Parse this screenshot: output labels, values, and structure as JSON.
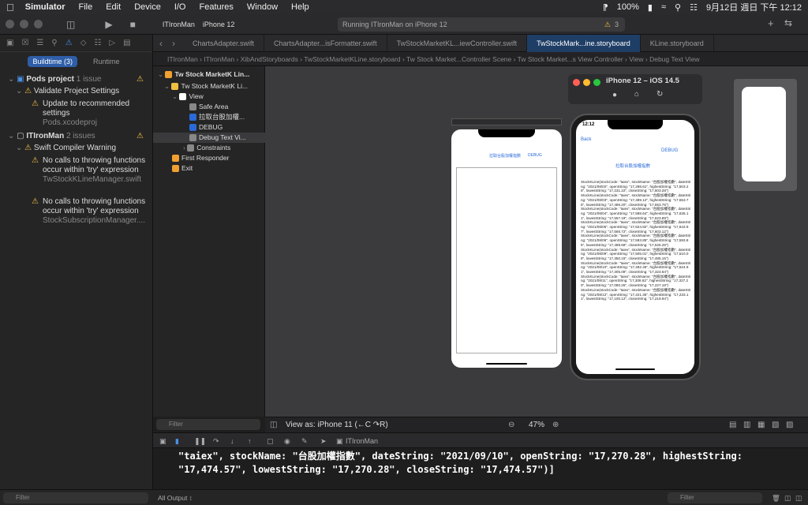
{
  "menubar": {
    "app": "Simulator",
    "items": [
      "File",
      "Edit",
      "Device",
      "I/O",
      "Features",
      "Window",
      "Help"
    ],
    "battery": "100%",
    "datetime": "9月12日 週日 下午 12:12"
  },
  "toolbar": {
    "scheme": "ITIronMan",
    "device": "iPhone 12",
    "status": "Running ITIronMan on iPhone 12",
    "warning_count": "3"
  },
  "nav": {
    "segments": [
      "Buildtime (3)",
      "Runtime"
    ],
    "issues": [
      {
        "title": "Pods project",
        "count": "1 issue"
      },
      {
        "title": "Validate Project Settings"
      },
      {
        "title": "Update to recommended settings",
        "file": "Pods.xcodeproj"
      },
      {
        "title": "ITIronMan",
        "count": "2 issues"
      },
      {
        "title": "Swift Compiler Warning"
      },
      {
        "title": "No calls to throwing functions occur within 'try' expression",
        "file": "TwStockKLineManager.swift"
      },
      {
        "title": "No calls to throwing functions occur within 'try' expression",
        "file": "StockSubscriptionManager...."
      }
    ],
    "filter_placeholder": "Filter"
  },
  "tabs": [
    "ChartsAdapter.swift",
    "ChartsAdapter...isFormatter.swift",
    "TwStockMarketKL...iewController.swift",
    "TwStockMark...ine.storyboard",
    "KLine.storyboard"
  ],
  "breadcrumb": [
    "ITIronMan",
    "ITIronMan",
    "XibAndStoryboards",
    "TwStockMarketKLine.storyboard",
    "Tw Stock Market...Controller Scene",
    "Tw Stock Market...s View Controller",
    "View",
    "Debug Text View"
  ],
  "outline": [
    {
      "label": "Tw Stock MarketK Lin...",
      "color": "#f0a030",
      "indent": 0
    },
    {
      "label": "Tw Stock MarketK Li...",
      "color": "#f0c040",
      "indent": 1
    },
    {
      "label": "View",
      "color": "#ffffff",
      "indent": 2
    },
    {
      "label": "Safe Area",
      "color": "#888888",
      "indent": 3
    },
    {
      "label": "拉取台股加權...",
      "color": "#2a6ad8",
      "indent": 3
    },
    {
      "label": "DEBUG",
      "color": "#2a6ad8",
      "indent": 3
    },
    {
      "label": "Debug Text Vi...",
      "color": "#888888",
      "indent": 3
    },
    {
      "label": "Constraints",
      "color": "#888888",
      "indent": 3
    },
    {
      "label": "First Responder",
      "color": "#f0a030",
      "indent": 1
    },
    {
      "label": "Exit",
      "color": "#f0a030",
      "indent": 1
    }
  ],
  "storyboard": {
    "button1": "拉取台股加權指數",
    "button2": "DEBUG"
  },
  "simulator": {
    "title": "iPhone 12 – iOS 14.5",
    "time": "12:12",
    "back": "Back",
    "debug": "DEBUG",
    "fetch": "拉取台股加權指數",
    "log": "StockKLine(stockCode: \"taiex\", stockName: \"台股加權指數\", dateString: \"2021/08/02\", openString: \"17,298.61\", highestString: \"17,503.28\", lowestString: \"17,231.22\", closeString: \"17,503.28\")\nStockKLine(stockCode: \"taiex\", stockName: \"台股加權指數\", dateString: \"2021/08/03\", openString: \"17,489.12\", highestString: \"17,553.76\", lowestString: \"17,486.20\", closeString: \"17,553.76\")\nStockKLine(stockCode: \"taiex\", stockName: \"台股加權指數\", dateString: \"2021/08/04\", openString: \"17,588.64\", highestString: \"17,636.11\", lowestString: \"17,557.18\", closeString: \"17,623.89\")\nStockKLine(stockCode: \"taiex\", stockName: \"台股加權指數\", dateString: \"2021/08/05\", openString: \"17,624.82\", highestString: \"17,643.97\", lowestString: \"17,566.72\", closeString: \"17,603.12\")\nStockKLine(stockCode: \"taiex\", stockName: \"台股加權指數\", dateString: \"2021/08/06\", openString: \"17,593.85\", highestString: \"17,593.85\", lowestString: \"17,489.68\", closeString: \"17,526.28\")\nStockKLine(stockCode: \"taiex\", stockName: \"台股加權指數\", dateString: \"2021/08/09\", openString: \"17,505.01\", highestString: \"17,510.09\", lowestString: \"17,350.15\", closeString: \"17,485.15\")\nStockKLine(stockCode: \"taiex\", stockName: \"台股加權指數\", dateString: \"2021/08/10\", openString: \"17,492.45\", highestString: \"17,524.91\", lowestString: \"17,305.08\", closeString: \"17,323.64\")\nStockKLine(stockCode: \"taiex\", stockName: \"台股加權指數\", dateString: \"2021/08/11\", openString: \"17,308.62\", highestString: \"17,327.20\", lowestString: \"17,080.25\", closeString: \"17,227.18\")\nStockKLine(stockCode: \"taiex\", stockName: \"台股加權指數\", dateString: \"2021/08/12\", openString: \"17,221.35\", highestString: \"17,233.11\", lowestString: \"17,100.12\", closeString: \"17,219.94\")"
  },
  "canvasbar": {
    "view_as": "View as: iPhone 11 (←C ↷R)",
    "zoom": "47%",
    "filter": "Filter"
  },
  "debug": {
    "target": "ITIronMan"
  },
  "console": {
    "line1": "\"taiex\", stockName: \"台股加權指數\", dateString: \"2021/09/10\", openString: \"17,270.28\", highestString:",
    "line2": "\"17,474.57\", lowestString: \"17,270.28\", closeString: \"17,474.57\")]"
  },
  "footer": {
    "output": "All Output ↕",
    "filter": "Filter"
  }
}
